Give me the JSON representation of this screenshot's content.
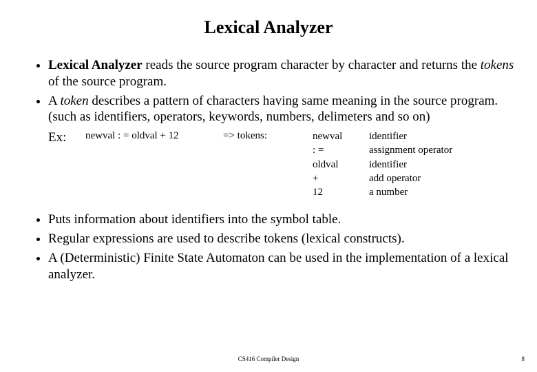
{
  "title": "Lexical Analyzer",
  "bullets_top": [
    {
      "bold": "Lexical Analyzer",
      "rest1": " reads the source program character by character and returns the ",
      "ital": "tokens",
      "rest2": " of the source program."
    },
    {
      "pre": "A ",
      "ital": "token",
      "rest": " describes a pattern of characters having same meaning in the source program. (such as identifiers, operators, keywords, numbers, delimeters and so on)"
    }
  ],
  "example": {
    "label": "Ex:",
    "code": "newval : = oldval + 12",
    "arrow": "=>  tokens:",
    "rows": [
      {
        "tok": "newval",
        "desc": "identifier"
      },
      {
        "tok": ": =",
        "desc": "assignment operator"
      },
      {
        "tok": "oldval",
        "desc": "identifier"
      },
      {
        "tok": "+",
        "desc": "add operator"
      },
      {
        "tok": "12",
        "desc": "a number"
      }
    ]
  },
  "bullets_bottom": [
    "Puts information about identifiers into the symbol table.",
    "Regular expressions are used to describe tokens (lexical constructs).",
    "A (Deterministic) Finite State Automaton can be used in the implementation of a lexical analyzer."
  ],
  "footer": "CS416 Compiler Design",
  "page": "8"
}
